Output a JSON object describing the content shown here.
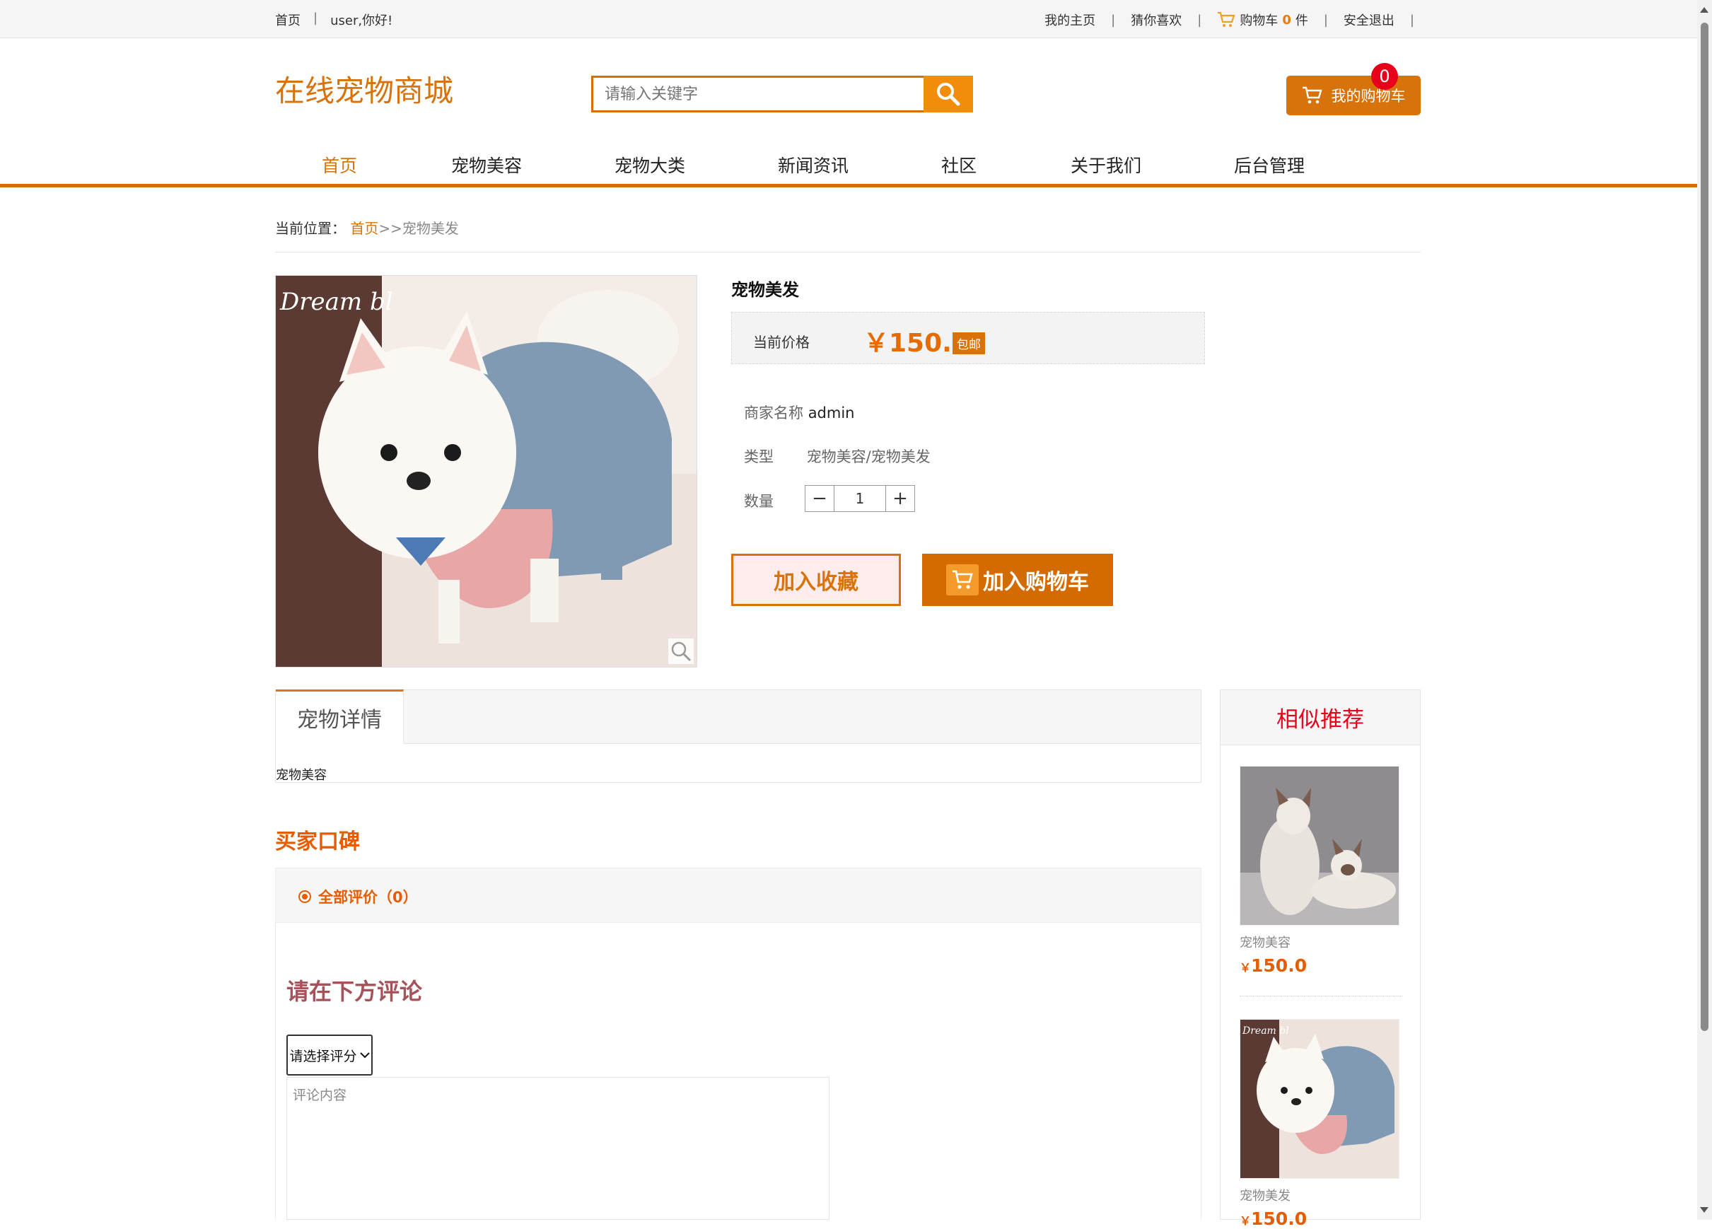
{
  "topbar": {
    "home": "首页",
    "sep": "|",
    "greeting": "user,你好!",
    "my_home": "我的主页",
    "guess_like": "猜你喜欢",
    "cart_prefix": "购物车",
    "cart_count": "0",
    "cart_suffix": "件",
    "logout": "安全退出"
  },
  "header": {
    "logo": "在线宠物商城",
    "search_placeholder": "请输入关键字",
    "my_cart": "我的购物车",
    "cart_badge": "0"
  },
  "nav": {
    "items": [
      {
        "label": "首页",
        "active": true
      },
      {
        "label": "宠物美容"
      },
      {
        "label": "宠物大类"
      },
      {
        "label": "新闻资讯"
      },
      {
        "label": "社区"
      },
      {
        "label": "关于我们"
      },
      {
        "label": "后台管理"
      }
    ]
  },
  "breadcrumb": {
    "label": "当前位置：",
    "home": "首页",
    "arrow": ">>",
    "current": "宠物美发"
  },
  "product": {
    "name": "宠物美发",
    "price_label": "当前价格",
    "price": "￥150.0",
    "free_shipping": "包邮",
    "merchant_label": "商家名称",
    "merchant": "admin",
    "type_label": "类型",
    "type": "宠物美容/宠物美发",
    "qty_label": "数量",
    "qty": "1",
    "minus": "−",
    "plus": "+",
    "fav_btn": "加入收藏",
    "cart_btn": "加入购物车"
  },
  "details": {
    "tab": "宠物详情",
    "body": "宠物美容"
  },
  "reviews": {
    "title": "买家口碑",
    "all": "全部评价（0）",
    "prompt": "请在下方评论",
    "select": "请选择评分",
    "placeholder": "评论内容"
  },
  "recommend": {
    "title": "相似推荐",
    "items": [
      {
        "name": "宠物美容",
        "currency": "￥",
        "price": "150.0"
      },
      {
        "name": "宠物美发",
        "currency": "￥",
        "price": "150.0"
      }
    ]
  },
  "colors": {
    "brand": "#d8730b",
    "price": "#e66b00",
    "badge": "#e6001a"
  }
}
